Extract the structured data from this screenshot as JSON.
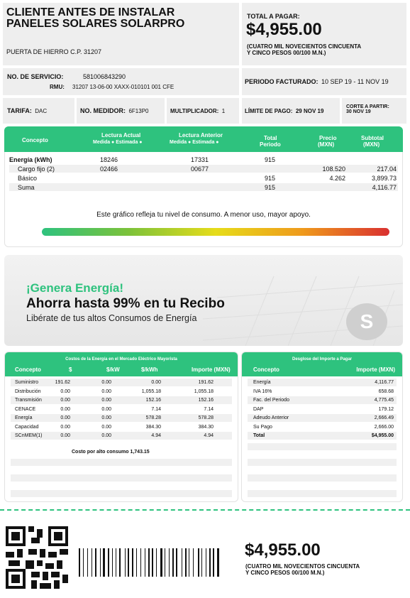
{
  "header": {
    "client_name": "CLIENTE ANTES DE INSTALAR",
    "client_name2": "PANELES SOLARES SOLARPRO",
    "address": "PUERTA DE HIERRO C.P. 31207",
    "total_label": "TOTAL A PAGAR:",
    "total_amount": "$4,955.00",
    "total_words": "(CUATRO MIL NOVECIENTOS CINCUENTA",
    "total_words2": "Y CINCO PESOS 00/100 M.N.)"
  },
  "service": {
    "service_label": "NO. DE SERVICIO:",
    "service_no": "581006843290",
    "rmu_label": "RMU:",
    "rmu": "31207 13-06-00 XAXX-010101 001 CFE",
    "period_label": "PERIODO FACTURADO:",
    "period": "10 SEP 19 - 11 NOV 19"
  },
  "tariff": {
    "tarifa_label": "TARIFA:",
    "tarifa": "DAC",
    "medidor_label": "NO. MEDIDOR:",
    "medidor": "6F13P0",
    "mult_label": "MULTIPLICADOR:",
    "mult": "1",
    "limit_label": "LÍMITE DE PAGO:",
    "limit": "29 NOV 19",
    "corte_label": "CORTE A PARTIR:",
    "corte": "30 NOV 19"
  },
  "consumption": {
    "h_concepto": "Concepto",
    "h_actual": "Lectura Actual",
    "h_actual_sub": "Medida ● Estimada ●",
    "h_anterior": "Lectura Anterior",
    "h_anterior_sub": "Medida ● Estimada ●",
    "h_total": "Total",
    "h_total2": "Periodo",
    "h_precio": "Precio",
    "h_precio2": "(MXN)",
    "h_subtotal": "Subtotal",
    "h_subtotal2": "(MXN)",
    "rows": [
      {
        "concept": "Energía (kWh)",
        "actual": "18246",
        "anterior": "17331",
        "total": "915",
        "precio": "",
        "subtotal": ""
      },
      {
        "concept": "Cargo fijo (2)",
        "actual": "02466",
        "anterior": "00677",
        "total": "",
        "precio": "108.520",
        "subtotal": "217.04"
      },
      {
        "concept": "Básico",
        "actual": "",
        "anterior": "",
        "total": "915",
        "precio": "4.262",
        "subtotal": "3,899.73"
      },
      {
        "concept": "Suma",
        "actual": "",
        "anterior": "",
        "total": "915",
        "precio": "",
        "subtotal": "4,116.77"
      }
    ],
    "gauge_text": "Este gráfico refleja tu nivel de consumo. A menor uso, mayor apoyo."
  },
  "banner": {
    "line1": "¡Genera Energía!",
    "line2": "Ahorra hasta 99% en tu Recibo",
    "line3": "Libérate de tus altos Consumos de Energía",
    "logo_letter": "S"
  },
  "costs": {
    "title": "Costos de la Energía en el Mercado Eléctrico Mayorista",
    "h": [
      "Concepto",
      "$",
      "$/kW",
      "$/kWh",
      "Importe (MXN)"
    ],
    "rows": [
      [
        "Suministro",
        "191.62",
        "0.00",
        "0.00",
        "191.62"
      ],
      [
        "Distribución",
        "0.00",
        "0.00",
        "1,055.18",
        "1,055.18"
      ],
      [
        "Transmisión",
        "0.00",
        "0.00",
        "152.16",
        "152.16"
      ],
      [
        "CENACE",
        "0.00",
        "0.00",
        "7.14",
        "7.14"
      ],
      [
        "Energía",
        "0.00",
        "0.00",
        "578.28",
        "578.28"
      ],
      [
        "Capacidad",
        "0.00",
        "0.00",
        "384.30",
        "384.30"
      ],
      [
        "SCnMEM(1)",
        "0.00",
        "0.00",
        "4.94",
        "4.94"
      ]
    ],
    "high_cost": "Costo por alto consumo 1,743.15"
  },
  "breakdown": {
    "title": "Desglose del Importe a Pagar",
    "h": [
      "Concepto",
      "Importe (MXN)"
    ],
    "rows": [
      [
        "Energía",
        "4,116.77"
      ],
      [
        "IVA 16%",
        "658.68"
      ],
      [
        "Fac. del Periodo",
        "4,775.45"
      ],
      [
        "DAP",
        "179.12"
      ],
      [
        "Adeudo Anterior",
        "2,666.49"
      ],
      [
        "Su Pago",
        "2,666.00"
      ],
      [
        "Total",
        "$4,955.00"
      ]
    ]
  },
  "footer": {
    "amount": "$4,955.00",
    "words": "(CUATRO MIL NOVECIENTOS CINCUENTA",
    "words2": "Y CINCO PESOS 00/100 M.N.)"
  },
  "colors": {
    "green": "#2ec27e",
    "gray_bg": "#eeeeee"
  }
}
